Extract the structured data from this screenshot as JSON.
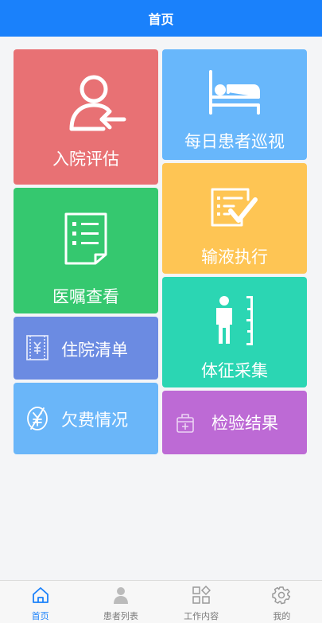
{
  "header": {
    "title": "首页"
  },
  "tiles": {
    "admission": {
      "label": "入院评估",
      "icon": "user-return-icon",
      "color": "#e87174"
    },
    "rounds": {
      "label": "每日患者巡视",
      "icon": "bed-icon",
      "color": "#68b7fb"
    },
    "infusion": {
      "label": "输液执行",
      "icon": "checklist-icon",
      "color": "#fec554"
    },
    "orders": {
      "label": "医嘱查看",
      "icon": "document-list-icon",
      "color": "#35c86f"
    },
    "vitals": {
      "label": "体征采集",
      "icon": "height-measure-icon",
      "color": "#2bd6b3"
    },
    "bill": {
      "label": "住院清单",
      "icon": "yuan-receipt-icon",
      "color": "#6b8be2"
    },
    "arrears": {
      "label": "欠费情况",
      "icon": "no-yuan-icon",
      "color": "#6ab6f9"
    },
    "lab": {
      "label": "检验结果",
      "icon": "medical-kit-icon",
      "color": "#bd6ad5"
    }
  },
  "tabbar": {
    "items": [
      {
        "label": "首页",
        "icon": "home-icon",
        "active": true
      },
      {
        "label": "患者列表",
        "icon": "person-icon",
        "active": false
      },
      {
        "label": "工作内容",
        "icon": "grid-icon",
        "active": false
      },
      {
        "label": "我的",
        "icon": "gear-icon",
        "active": false
      }
    ],
    "active_color": "#1a81fb"
  }
}
